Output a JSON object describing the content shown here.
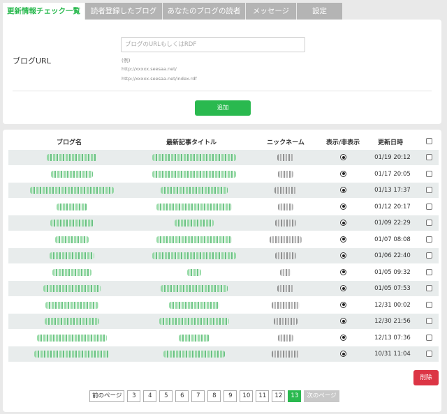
{
  "tabs": [
    {
      "label": "更新情報チェック一覧",
      "active": true
    },
    {
      "label": "読者登録したブログ",
      "active": false
    },
    {
      "label": "あなたのブログの読者",
      "active": false
    },
    {
      "label": "メッセージ",
      "active": false
    },
    {
      "label": "設定",
      "active": false
    }
  ],
  "form": {
    "url_label": "ブログURL",
    "url_placeholder": "ブログのURLもしくはRDF",
    "example_label": "(例)",
    "examples": [
      "http://xxxxx.seesaa.net/",
      "http://xxxxx.seesaa.net/index.rdf"
    ],
    "add_button": "追加"
  },
  "table": {
    "headers": {
      "blog_name": "ブログ名",
      "latest_title": "最新記事タイトル",
      "nickname": "ニックネーム",
      "visibility": "表示/非表示",
      "updated": "更新日時"
    },
    "rows": [
      {
        "updated": "01/19 20:12",
        "visible": true
      },
      {
        "updated": "01/17 20:05",
        "visible": true
      },
      {
        "updated": "01/13 17:37",
        "visible": true
      },
      {
        "updated": "01/12 20:17",
        "visible": true
      },
      {
        "updated": "01/09 22:29",
        "visible": true
      },
      {
        "updated": "01/07 08:08",
        "visible": true
      },
      {
        "updated": "01/06 22:40",
        "visible": true
      },
      {
        "updated": "01/05 09:32",
        "visible": true
      },
      {
        "updated": "01/05 07:53",
        "visible": true
      },
      {
        "updated": "12/31 00:02",
        "visible": true
      },
      {
        "updated": "12/30 21:56",
        "visible": true
      },
      {
        "updated": "12/13 07:36",
        "visible": true
      },
      {
        "updated": "10/31 11:04",
        "visible": true
      }
    ]
  },
  "delete_button": "削除",
  "pagination": {
    "prev": "前のページ",
    "pages": [
      "3",
      "4",
      "5",
      "6",
      "7",
      "8",
      "9",
      "10",
      "11",
      "12",
      "13"
    ],
    "current": "13",
    "next": "次のページ"
  },
  "colors": {
    "accent": "#2ab94f",
    "danger": "#dc3545",
    "tab_inactive": "#b4b4b4",
    "row_alt": "#e8ecec"
  }
}
